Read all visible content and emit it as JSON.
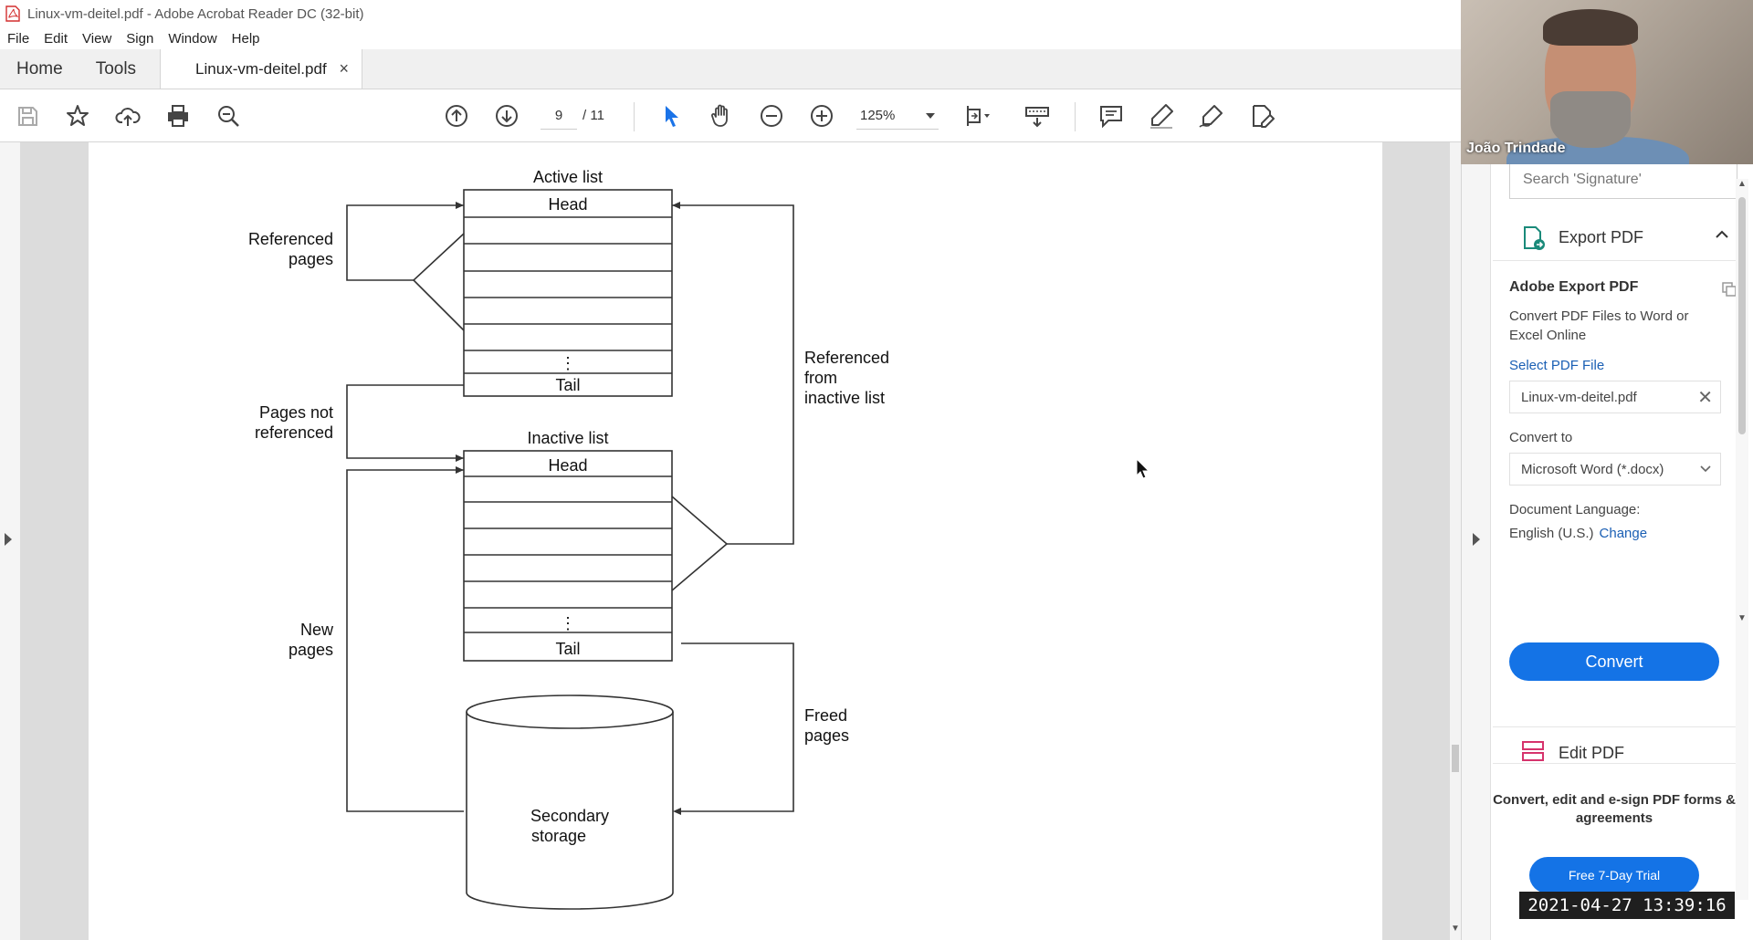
{
  "window": {
    "title": "Linux-vm-deitel.pdf - Adobe Acrobat Reader DC (32-bit)"
  },
  "menu": [
    "File",
    "Edit",
    "View",
    "Sign",
    "Window",
    "Help"
  ],
  "tabs": {
    "home": "Home",
    "tools": "Tools",
    "document": "Linux-vm-deitel.pdf",
    "close": "×"
  },
  "toolbar": {
    "page_current": "9",
    "page_total": "/ 11",
    "zoom": "125%"
  },
  "diagram": {
    "active_list": "Active list",
    "head1": "Head",
    "dots": "⋮",
    "tail1": "Tail",
    "inactive_list": "Inactive list",
    "head2": "Head",
    "tail2": "Tail",
    "referenced_pages": [
      "Referenced",
      "pages"
    ],
    "pages_not_referenced": [
      "Pages not",
      "referenced"
    ],
    "new_pages": [
      "New",
      "pages"
    ],
    "referenced_from_inactive": [
      "Referenced",
      "from",
      "inactive list"
    ],
    "freed_pages": [
      "Freed",
      "pages"
    ],
    "secondary_storage": [
      "Secondary",
      "storage"
    ]
  },
  "panel": {
    "search_placeholder": "Search 'Signature'",
    "export_title": "Export PDF",
    "adobe_export_heading": "Adobe Export PDF",
    "description": "Convert PDF Files to Word or Excel Online",
    "select_file_link": "Select PDF File",
    "selected_file": "Linux-vm-deitel.pdf",
    "convert_to_label": "Convert to",
    "convert_format": "Microsoft Word (*.docx)",
    "doc_language_label": "Document Language:",
    "doc_language_value": "English (U.S.)",
    "change_link": "Change",
    "convert_button": "Convert",
    "edit_pdf": "Edit PDF",
    "promo_text": "Convert, edit and e-sign PDF forms & agreements",
    "trial_button": "Free 7-Day Trial"
  },
  "webcam": {
    "participant_name": "João Trindade"
  },
  "timestamp": "2021-04-27  13:39:16",
  "colors": {
    "accent_blue": "#1473e6",
    "link_blue": "#1a5fb4",
    "cursor_blue": "#1a73e8"
  }
}
